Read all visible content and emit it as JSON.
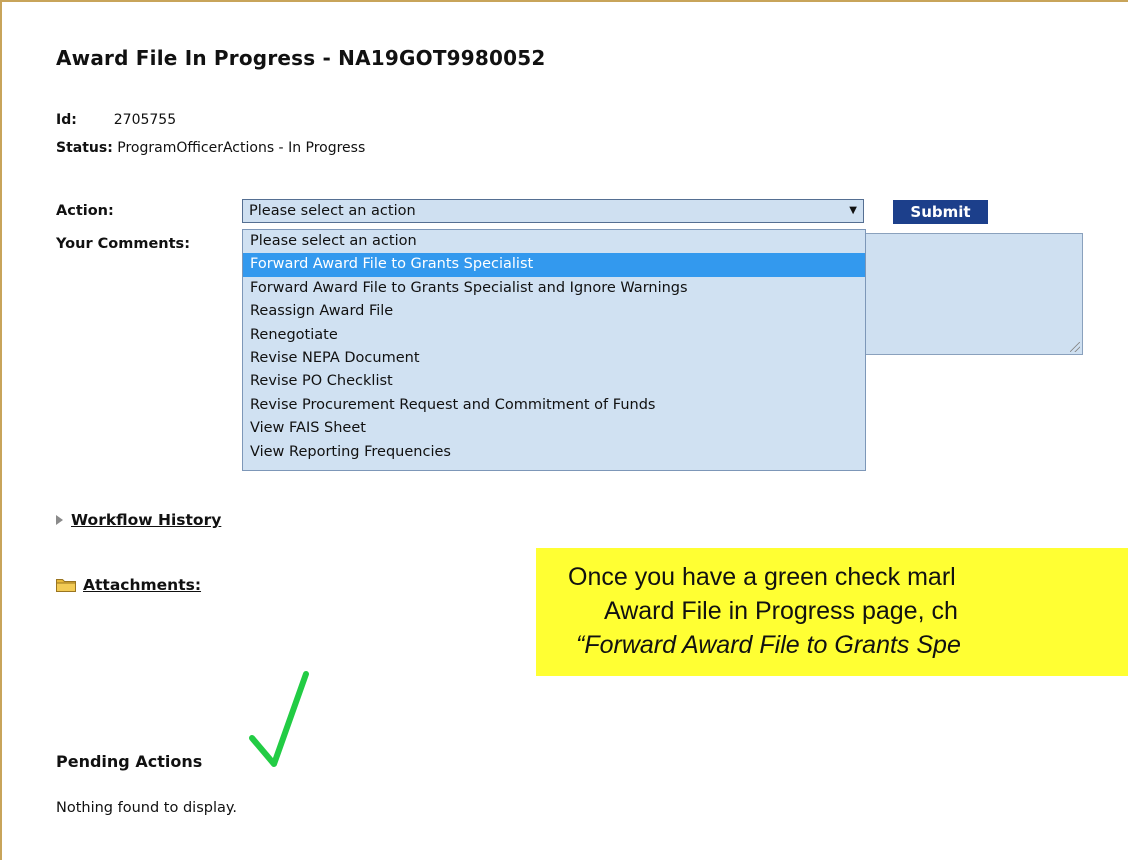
{
  "page_title": "Award File In Progress - NA19GOT9980052",
  "id_label": "Id:",
  "id_value": "2705755",
  "status_label": "Status:",
  "status_value": "ProgramOfficerActions - In Progress",
  "action_label": "Action:",
  "action_select": {
    "selected": "Please select an action",
    "options": [
      "Please select an action",
      "Forward Award File to Grants Specialist",
      "Forward Award File to Grants Specialist and Ignore Warnings",
      "Reassign Award File",
      "Renegotiate",
      "Revise NEPA Document",
      "Revise PO Checklist",
      "Revise Procurement Request and Commitment of Funds",
      "View FAIS Sheet",
      "View Reporting Frequencies"
    ],
    "highlighted_index": 1
  },
  "submit_label": "Submit",
  "comments_label": "Your Comments:",
  "workflow_history_label": "Workflow History",
  "attachments_label": "Attachments:",
  "callout": {
    "line1": "Once you have a green check marl",
    "line2": "Award File in Progress page, ch",
    "line3": "“Forward Award File to Grants Spe"
  },
  "pending_actions_label": "Pending Actions",
  "nothing_found": "Nothing found to display.",
  "colors": {
    "submit_bg": "#1c3f8b",
    "select_bg": "#cfe0f1",
    "highlight": "#3399ee",
    "callout_bg": "#ffff33",
    "check": "#22cc44",
    "frame": "#c8a45a"
  }
}
